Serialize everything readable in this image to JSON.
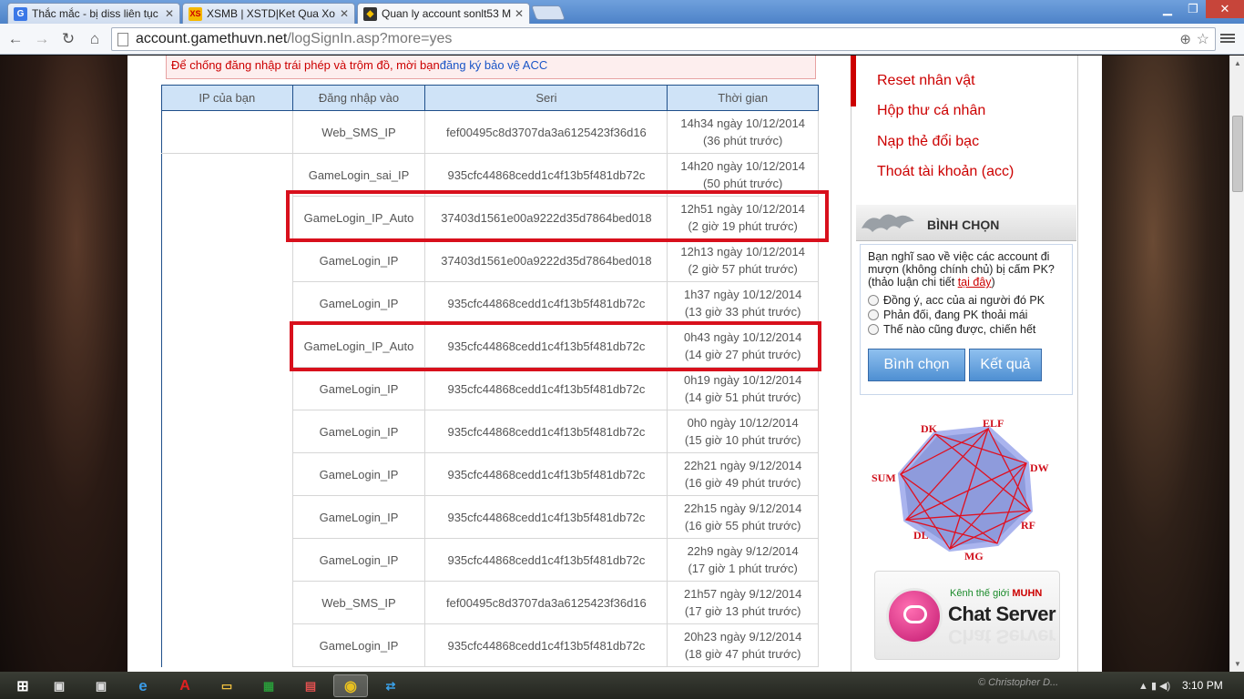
{
  "browser": {
    "tabs": [
      {
        "title": "Thắc mắc - bị diss liên tục",
        "icon": "google-icon",
        "color": "#3b78e7",
        "glyph": "G"
      },
      {
        "title": "XSMB | XSTD|Ket Qua Xo S",
        "icon": "xs-icon",
        "color": "#f5b800",
        "glyph": "XS"
      },
      {
        "title": "Quan ly account sonlt53 M",
        "icon": "game-icon",
        "color": "#333",
        "glyph": "◆"
      }
    ],
    "url_host": "account.gamethuvn.net",
    "url_path": "/logSignIn.asp?more=yes"
  },
  "notice": {
    "text": "Để chống đăng nhập trái phép và trộm đồ, mời bạn",
    "link": "đăng ký bảo vệ ACC"
  },
  "table": {
    "headers": [
      "IP của bạn",
      "Đăng nhập vào",
      "Seri",
      "Thời gian"
    ],
    "rows": [
      {
        "ip": "",
        "login": "Web_SMS_IP",
        "seri": "fef00495c8d3707da3a6125423f36d16",
        "time": "14h34 ngày 10/12/2014",
        "ago": "(36 phút trước)"
      },
      {
        "ip": "",
        "login": "GameLogin_sai_IP",
        "seri": "935cfc44868cedd1c4f13b5f481db72c",
        "time": "14h20 ngày 10/12/2014",
        "ago": "(50 phút trước)"
      },
      {
        "ip": "",
        "login": "GameLogin_IP_Auto",
        "seri": "37403d1561e00a9222d35d7864bed018",
        "time": "12h51 ngày 10/12/2014",
        "ago": "(2 giờ 19 phút trước)"
      },
      {
        "ip": "",
        "login": "GameLogin_IP",
        "seri": "37403d1561e00a9222d35d7864bed018",
        "time": "12h13 ngày 10/12/2014",
        "ago": "(2 giờ 57 phút trước)"
      },
      {
        "ip": "",
        "login": "GameLogin_IP",
        "seri": "935cfc44868cedd1c4f13b5f481db72c",
        "time": "1h37 ngày 10/12/2014",
        "ago": "(13 giờ 33 phút trước)"
      },
      {
        "ip": "",
        "login": "GameLogin_IP_Auto",
        "seri": "935cfc44868cedd1c4f13b5f481db72c",
        "time": "0h43 ngày 10/12/2014",
        "ago": "(14 giờ 27 phút trước)"
      },
      {
        "ip": "",
        "login": "GameLogin_IP",
        "seri": "935cfc44868cedd1c4f13b5f481db72c",
        "time": "0h19 ngày 10/12/2014",
        "ago": "(14 giờ 51 phút trước)"
      },
      {
        "ip": "",
        "login": "GameLogin_IP",
        "seri": "935cfc44868cedd1c4f13b5f481db72c",
        "time": "0h0 ngày 10/12/2014",
        "ago": "(15 giờ 10 phút trước)"
      },
      {
        "ip": "",
        "login": "GameLogin_IP",
        "seri": "935cfc44868cedd1c4f13b5f481db72c",
        "time": "22h21 ngày 9/12/2014",
        "ago": "(16 giờ 49 phút trước)"
      },
      {
        "ip": "",
        "login": "GameLogin_IP",
        "seri": "935cfc44868cedd1c4f13b5f481db72c",
        "time": "22h15 ngày 9/12/2014",
        "ago": "(16 giờ 55 phút trước)"
      },
      {
        "ip": "",
        "login": "GameLogin_IP",
        "seri": "935cfc44868cedd1c4f13b5f481db72c",
        "time": "22h9 ngày 9/12/2014",
        "ago": "(17 giờ 1 phút trước)"
      },
      {
        "ip": "",
        "login": "Web_SMS_IP",
        "seri": "fef00495c8d3707da3a6125423f36d16",
        "time": "21h57 ngày 9/12/2014",
        "ago": "(17 giờ 13 phút trước)"
      },
      {
        "ip": "",
        "login": "GameLogin_IP",
        "seri": "935cfc44868cedd1c4f13b5f481db72c",
        "time": "20h23 ngày 9/12/2014",
        "ago": "(18 giờ 47 phút trước)"
      }
    ],
    "highlighted_rows": [
      2,
      5
    ],
    "highlight_color": "#d8101c"
  },
  "sidebar": {
    "links": [
      "Reset nhân vật",
      "Hộp thư cá nhân",
      "Nạp thẻ đổi bạc",
      "Thoát tài khoản (acc)"
    ],
    "poll": {
      "title": "BÌNH CHỌN",
      "question": "Bạn nghĩ sao về việc các account đi mượn (không chính chủ) bị cấm PK? (thảo luận chi tiết",
      "question_link": "tại đây",
      "question_end": ")",
      "options": [
        "Đồng ý, acc của ai người đó PK",
        "Phản đối, đang PK thoải mái",
        "Thế nào cũng được, chiến hết"
      ],
      "vote_button": "Bình chọn",
      "result_button": "Kết quả"
    },
    "classes": [
      "DK",
      "ELF",
      "DW",
      "RF",
      "MG",
      "DL",
      "SUM"
    ],
    "chat": {
      "subtitle": "Kênh thế giới",
      "subtitle_brand": "MUHN",
      "title": "Chat Server"
    }
  },
  "taskbar": {
    "clock": "3:10 PM",
    "watermark": "© Christopher D..."
  }
}
